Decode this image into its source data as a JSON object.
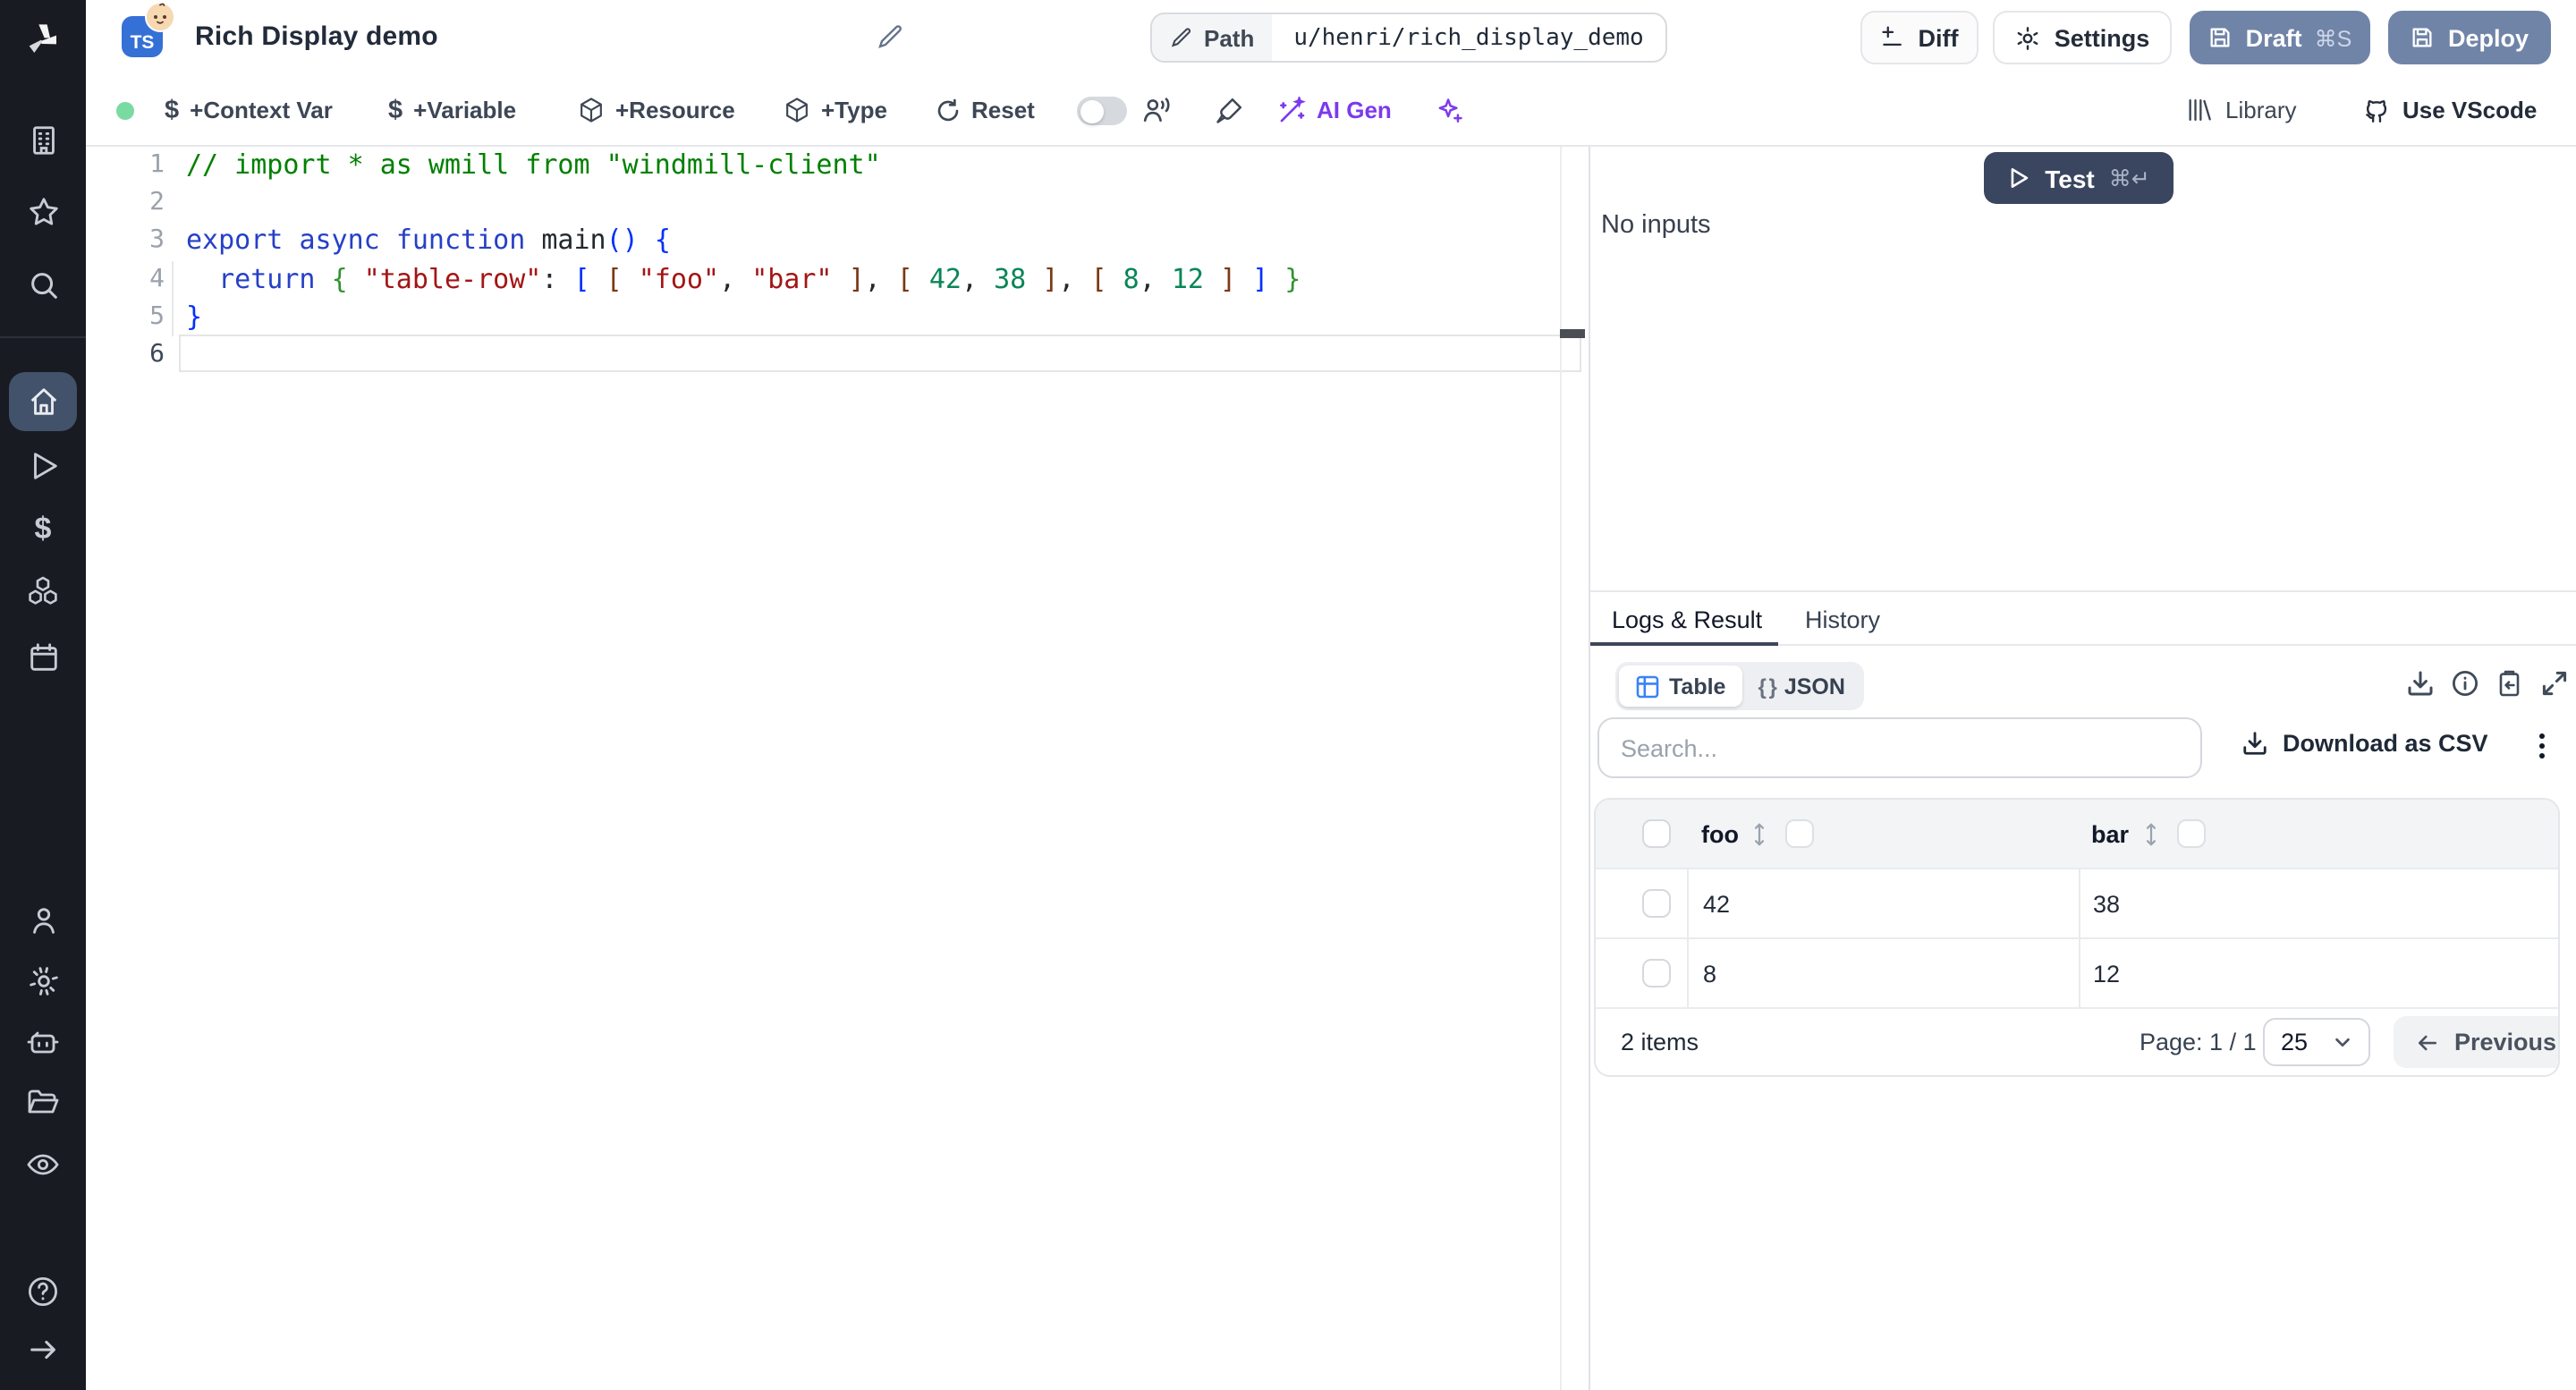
{
  "header": {
    "title": "Rich Display demo",
    "lang_badge": "TS",
    "path_label": "Path",
    "path_value": "u/henri/rich_display_demo",
    "diff_label": "Diff",
    "settings_label": "Settings",
    "draft_label": "Draft",
    "draft_shortcut": "⌘S",
    "deploy_label": "Deploy"
  },
  "toolbar": {
    "add_context_var": "+Context Var",
    "add_variable": "+Variable",
    "add_resource": "+Resource",
    "add_type": "+Type",
    "reset": "Reset",
    "ai_gen": "AI Gen",
    "library": "Library",
    "use_vscode": "Use VScode",
    "icons": [
      "status-dot",
      "dollar-icon",
      "dollar-icon",
      "package-icon",
      "package-icon",
      "reset-icon",
      "toggle-off",
      "multiplayer-icon",
      "format-brush-icon",
      "magic-wand-icon",
      "sparkles-icon",
      "library-icon",
      "github-icon"
    ]
  },
  "sidebar": {
    "icons": [
      "windmill-logo",
      "building-icon",
      "star-icon",
      "search-icon",
      "home-icon",
      "play-icon",
      "dollar-icon",
      "cubes-icon",
      "calendar-icon",
      "user-icon",
      "gear-icon",
      "robot-icon",
      "folder-icon",
      "eye-icon",
      "help-icon",
      "arrow-right-icon"
    ],
    "active_item": "home"
  },
  "editor": {
    "line_numbers": [
      "1",
      "2",
      "3",
      "4",
      "5",
      "6"
    ],
    "current_line": 6,
    "lines": [
      [
        [
          "cm",
          "// import * as wmill from \"windmill-client\""
        ]
      ],
      [],
      [
        [
          "kw",
          "export"
        ],
        [
          "pl",
          " "
        ],
        [
          "kw",
          "async"
        ],
        [
          "pl",
          " "
        ],
        [
          "kw",
          "function"
        ],
        [
          "pl",
          " "
        ],
        [
          "fn",
          "main"
        ],
        [
          "b1",
          "("
        ],
        [
          "b1",
          ")"
        ],
        [
          "pl",
          " "
        ],
        [
          "b1",
          "{"
        ]
      ],
      [
        [
          "pl",
          "  "
        ],
        [
          "kw",
          "return"
        ],
        [
          "pl",
          " "
        ],
        [
          "b2",
          "{"
        ],
        [
          "pl",
          " "
        ],
        [
          "st",
          "\"table-row\""
        ],
        [
          "pl",
          ": "
        ],
        [
          "b1",
          "["
        ],
        [
          "pl",
          " "
        ],
        [
          "b3",
          "["
        ],
        [
          "pl",
          " "
        ],
        [
          "st",
          "\"foo\""
        ],
        [
          "pl",
          ", "
        ],
        [
          "st",
          "\"bar\""
        ],
        [
          "pl",
          " "
        ],
        [
          "b3",
          "]"
        ],
        [
          "pl",
          ", "
        ],
        [
          "b3",
          "["
        ],
        [
          "pl",
          " "
        ],
        [
          "nu",
          "42"
        ],
        [
          "pl",
          ", "
        ],
        [
          "nu",
          "38"
        ],
        [
          "pl",
          " "
        ],
        [
          "b3",
          "]"
        ],
        [
          "pl",
          ", "
        ],
        [
          "b3",
          "["
        ],
        [
          "pl",
          " "
        ],
        [
          "nu",
          "8"
        ],
        [
          "pl",
          ", "
        ],
        [
          "nu",
          "12"
        ],
        [
          "pl",
          " "
        ],
        [
          "b3",
          "]"
        ],
        [
          "pl",
          " "
        ],
        [
          "b1",
          "]"
        ],
        [
          "pl",
          " "
        ],
        [
          "b2",
          "}"
        ]
      ],
      [
        [
          "b1",
          "}"
        ]
      ],
      []
    ]
  },
  "run_panel": {
    "test_label": "Test",
    "test_shortcut": "⌘↵",
    "no_inputs": "No inputs",
    "tab_logs": "Logs & Result",
    "tab_history": "History",
    "view_table": "Table",
    "view_json": "JSON",
    "json_braces_icon": "{ }",
    "action_icons": [
      "download-icon",
      "info-icon",
      "clipboard-copy-icon",
      "expand-icon"
    ],
    "search_placeholder": "Search...",
    "download_csv": "Download as CSV",
    "table": {
      "columns": [
        "foo",
        "bar"
      ],
      "rows": [
        [
          "42",
          "38"
        ],
        [
          "8",
          "12"
        ]
      ],
      "items_label": "2 items",
      "page_label": "Page: 1 / 1",
      "page_size": "25",
      "previous_label": "Previous"
    }
  },
  "colors": {
    "sidebar_bg": "#181b21",
    "sidebar_active_bg": "#42526b",
    "slate_button": "#7084a8",
    "test_button": "#3a4660",
    "ts_badge_blue": "#3570d6",
    "status_green": "#79dba2",
    "accent_purple": "#7c3aed",
    "table_icon_blue": "#3b82f6",
    "tab_underline": "#3d4758"
  }
}
